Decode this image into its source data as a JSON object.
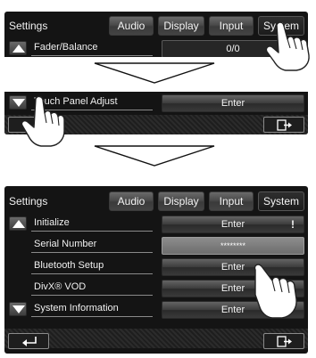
{
  "top_screen": {
    "title": "Settings",
    "tabs": [
      {
        "label": "Audio"
      },
      {
        "label": "Display"
      },
      {
        "label": "Input"
      },
      {
        "label": "System"
      }
    ],
    "row": {
      "label": "Fader/Balance",
      "value": "0/0"
    }
  },
  "middle_screen": {
    "row": {
      "label": "Touch Panel Adjust",
      "button": "Enter"
    }
  },
  "bottom_screen": {
    "title": "Settings",
    "tabs": [
      {
        "label": "Audio"
      },
      {
        "label": "Display"
      },
      {
        "label": "Input"
      },
      {
        "label": "System"
      }
    ],
    "rows": [
      {
        "label": "Initialize",
        "button": "Enter",
        "indicator": "!"
      },
      {
        "label": "Serial Number",
        "value": "********"
      },
      {
        "label": "Bluetooth Setup",
        "button": "Enter"
      },
      {
        "label": "DivX® VOD",
        "button": "Enter"
      },
      {
        "label": "System Information",
        "button": "Enter"
      }
    ]
  },
  "icons": {
    "scroll_up": "triangle-up-icon",
    "scroll_down": "triangle-down-icon",
    "back": "return-arrow-icon",
    "exit": "exit-door-icon",
    "pointer": "pointing-hand-icon",
    "flow": "flow-arrow-icon"
  }
}
